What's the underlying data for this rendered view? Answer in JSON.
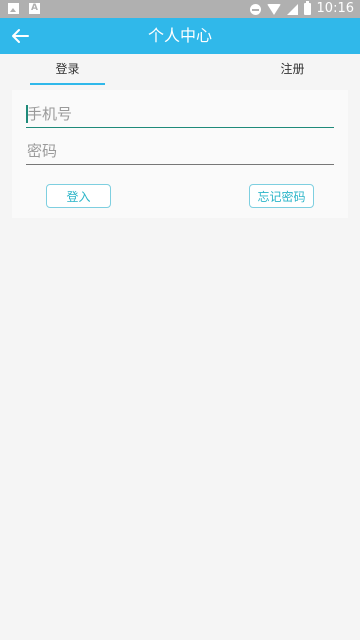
{
  "status_bar": {
    "time": "10:16",
    "icons": [
      "image-icon",
      "text-a-icon",
      "do-not-disturb-icon",
      "wifi-icon",
      "signal-icon",
      "battery-icon"
    ]
  },
  "app_bar": {
    "title": "个人中心",
    "back_icon": "arrow-left-icon",
    "background": "#30b8ea"
  },
  "tabs": [
    {
      "label": "登录",
      "selected": true
    },
    {
      "label": "注册",
      "selected": false
    }
  ],
  "form": {
    "phone": {
      "placeholder": "手机号",
      "value": ""
    },
    "password": {
      "placeholder": "密码",
      "value": ""
    },
    "login_button": "登入",
    "forgot_button": "忘记密码"
  },
  "colors": {
    "accent": "#30b8ea",
    "button_text": "#2bb5c8",
    "focused_underline": "#1f8a7a"
  }
}
